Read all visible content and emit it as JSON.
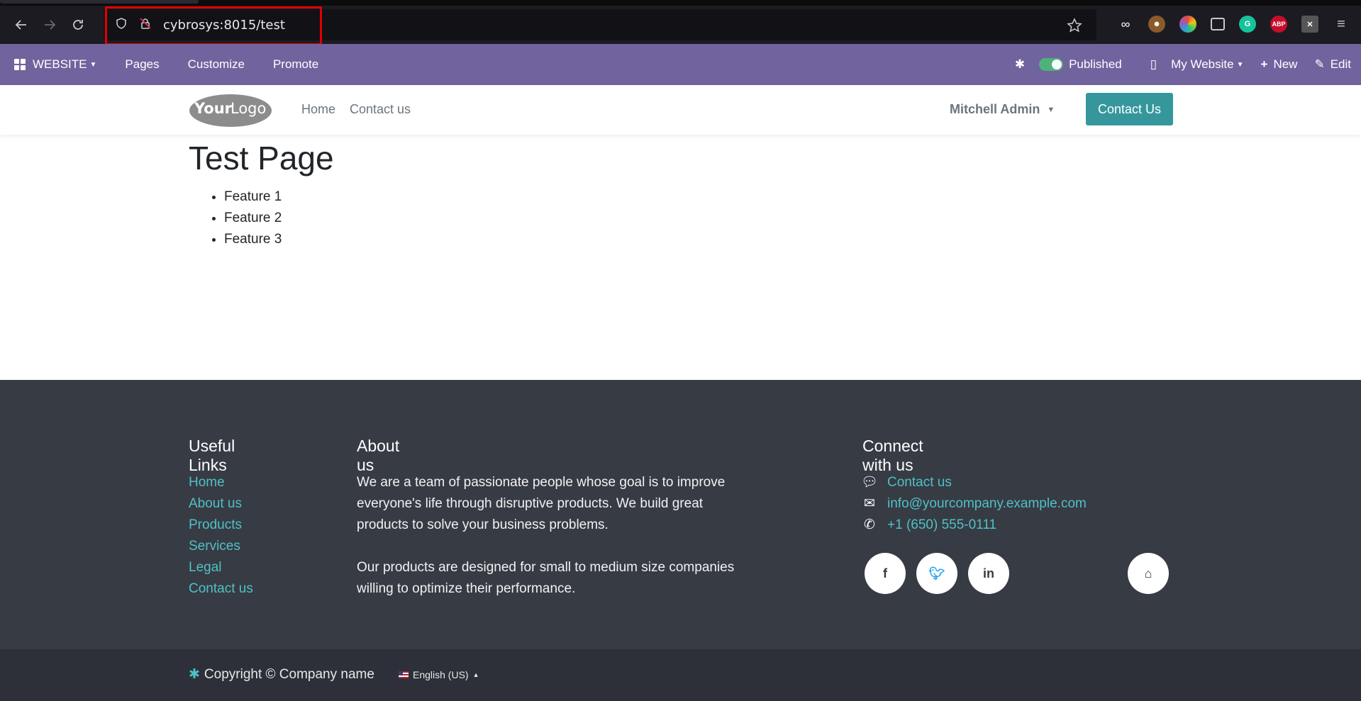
{
  "browser": {
    "url": "cybrosys:8015/test"
  },
  "admin_bar": {
    "app_label": "WEBSITE",
    "menu": [
      "Pages",
      "Customize",
      "Promote"
    ],
    "published_label": "Published",
    "website_label": "My Website",
    "new_label": "New",
    "edit_label": "Edit"
  },
  "header": {
    "nav": [
      "Home",
      "Contact us"
    ],
    "user_name": "Mitchell Admin",
    "cta_label": "Contact Us"
  },
  "content": {
    "title": "Test Page",
    "features": [
      "Feature 1",
      "Feature 2",
      "Feature 3"
    ]
  },
  "footer": {
    "useful_links_title": "Useful Links",
    "useful_links": [
      "Home",
      "About us",
      "Products",
      "Services",
      "Legal",
      "Contact us"
    ],
    "about_title": "About us",
    "about_p1": "We are a team of passionate people whose goal is to improve everyone's life through disruptive products. We build great products to solve your business problems.",
    "about_p2": "Our products are designed for small to medium size companies willing to optimize their performance.",
    "connect_title": "Connect with us",
    "contact_link": "Contact us",
    "email": "info@yourcompany.example.com",
    "phone": "+1 (650) 555-0111",
    "copyright": "Copyright © Company name",
    "language": "English (US)"
  },
  "colors": {
    "odoo_purple": "#71639e",
    "teal": "#35979c",
    "footer_bg": "#373b44",
    "link": "#4fc1c5",
    "highlight": "#e00000"
  }
}
